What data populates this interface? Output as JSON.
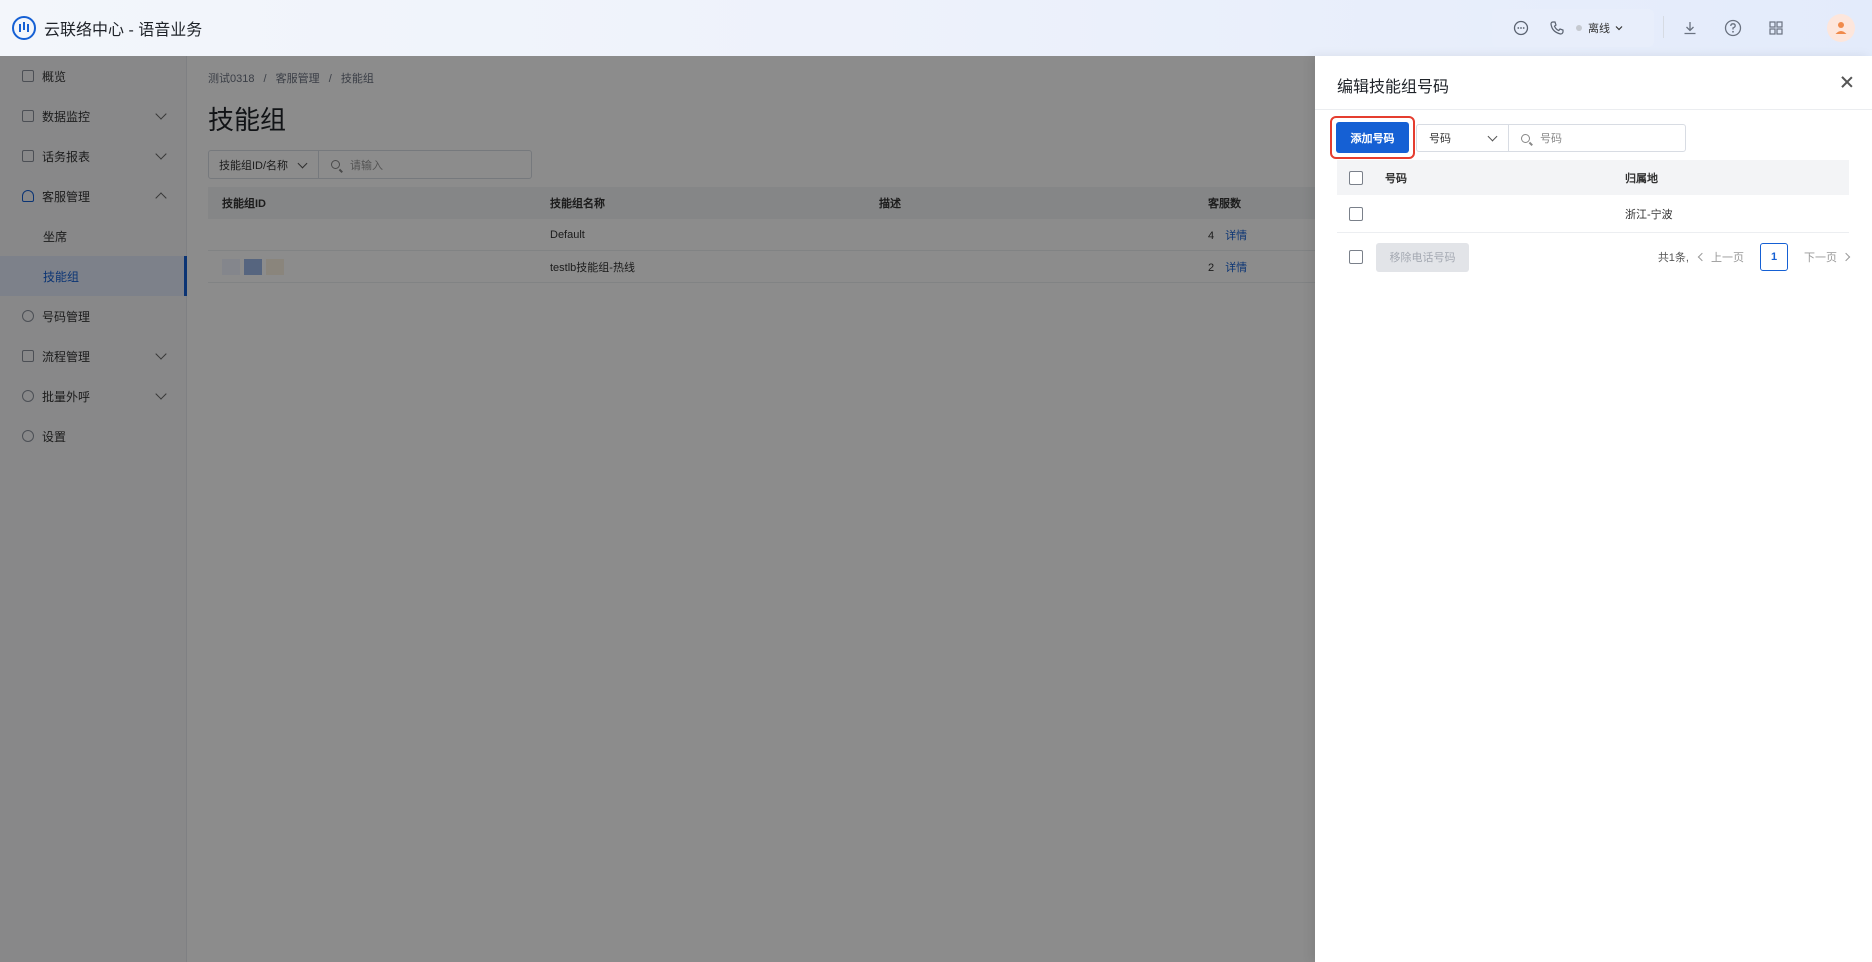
{
  "app": {
    "title": "云联络中心 - 语音业务"
  },
  "topbar": {
    "status_label": "离线",
    "icons": [
      "chat-icon",
      "phone-icon",
      "download-icon",
      "help-icon",
      "apps-grid-icon"
    ]
  },
  "sidebar": {
    "items": [
      {
        "label": "概览"
      },
      {
        "label": "数据监控"
      },
      {
        "label": "话务报表"
      },
      {
        "label": "客服管理"
      },
      {
        "label": "坐席"
      },
      {
        "label": "技能组"
      },
      {
        "label": "号码管理"
      },
      {
        "label": "流程管理"
      },
      {
        "label": "批量外呼"
      },
      {
        "label": "设置"
      }
    ]
  },
  "main": {
    "breadcrumb": [
      "测试0318",
      "/",
      "客服管理",
      "/",
      "技能组"
    ],
    "page_title": "技能组",
    "filter": {
      "select_label": "技能组ID/名称",
      "input_placeholder": "请输入"
    },
    "table": {
      "headers": [
        "技能组ID",
        "技能组名称",
        "描述",
        "客服数"
      ],
      "rows": [
        {
          "id": "",
          "name": "Default",
          "desc": "",
          "count": "4",
          "link": "详情"
        },
        {
          "id": "",
          "name": "testlb技能组-热线",
          "desc": "",
          "count": "2",
          "link": "详情"
        }
      ]
    }
  },
  "drawer": {
    "title": "编辑技能组号码",
    "add_button": "添加号码",
    "filter": {
      "select_label": "号码",
      "input_placeholder": "号码"
    },
    "table": {
      "headers": [
        "号码",
        "归属地"
      ],
      "rows": [
        {
          "number": "",
          "location": "浙江-宁波"
        }
      ]
    },
    "remove_button": "移除电话号码",
    "pager": {
      "total": "共1条,",
      "prev": "上一页",
      "current": "1",
      "next": "下一页"
    }
  },
  "colors": {
    "accent": "#1560d4",
    "highlight": "#e53d2f"
  }
}
